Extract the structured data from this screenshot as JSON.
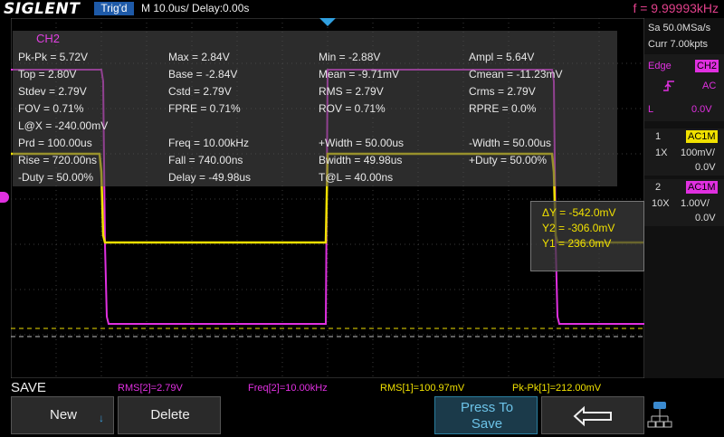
{
  "top": {
    "logo": "SIGLENT",
    "trig_status": "Trig'd",
    "timebase": "M 10.0us/  Delay:0.00s",
    "frequency": "f = 9.99993kHz"
  },
  "measurement_panel": {
    "channel": "CH2",
    "rows": [
      [
        "Pk-Pk = 5.72V",
        "Max = 2.84V",
        "Min = -2.88V",
        "Ampl = 5.64V"
      ],
      [
        "Top = 2.80V",
        "Base = -2.84V",
        "Mean = -9.71mV",
        "Cmean = -11.23mV"
      ],
      [
        "Stdev = 2.79V",
        "Cstd = 2.79V",
        "RMS = 2.79V",
        "Crms = 2.79V"
      ],
      [
        "FOV = 0.71%",
        "FPRE = 0.71%",
        "ROV = 0.71%",
        "RPRE = 0.0%"
      ],
      [
        "L@X = -240.00mV",
        "",
        "",
        ""
      ],
      [
        "Prd = 100.00us",
        "Freq = 10.00kHz",
        "+Width = 50.00us",
        "-Width = 50.00us"
      ],
      [
        "Rise = 720.00ns",
        "Fall = 740.00ns",
        "Bwidth = 49.98us",
        "+Duty = 50.00%"
      ],
      [
        "-Duty = 50.00%",
        "Delay = -49.98us",
        "T@L = 40.00ns",
        ""
      ]
    ]
  },
  "cursor": {
    "delta_y": "ΔY = -542.0mV",
    "y2": "Y2 = -306.0mV",
    "y1": "Y1 = 236.0mV"
  },
  "right_panel": {
    "sample_rate": "Sa 50.0MSa/s",
    "memory": "Curr 7.00kpts",
    "trigger_type": "Edge",
    "trigger_source": "CH2",
    "trigger_coupling": "AC",
    "trigger_level_label": "L",
    "trigger_level": "0.0V",
    "ch1": {
      "number": "1",
      "coupling": "AC1M",
      "probe": "1X",
      "scale": "100mV/",
      "offset": "0.0V"
    },
    "ch2": {
      "number": "2",
      "coupling": "AC1M",
      "probe": "10X",
      "scale": "1.00V/",
      "offset": "0.0V"
    }
  },
  "measure_strip": {
    "menu_title": "SAVE",
    "items": [
      "RMS[2]=2.79V",
      "Freq[2]=10.00kHz",
      "RMS[1]=100.97mV",
      "Pk-Pk[1]=212.00mV"
    ]
  },
  "softkeys": {
    "new": "New",
    "delete": "Delete",
    "press_to_save_line1": "Press To",
    "press_to_save_line2": "Save"
  },
  "colors": {
    "ch1": "#f0e000",
    "ch2": "#e030e0",
    "accent": "#1e5aa8"
  }
}
